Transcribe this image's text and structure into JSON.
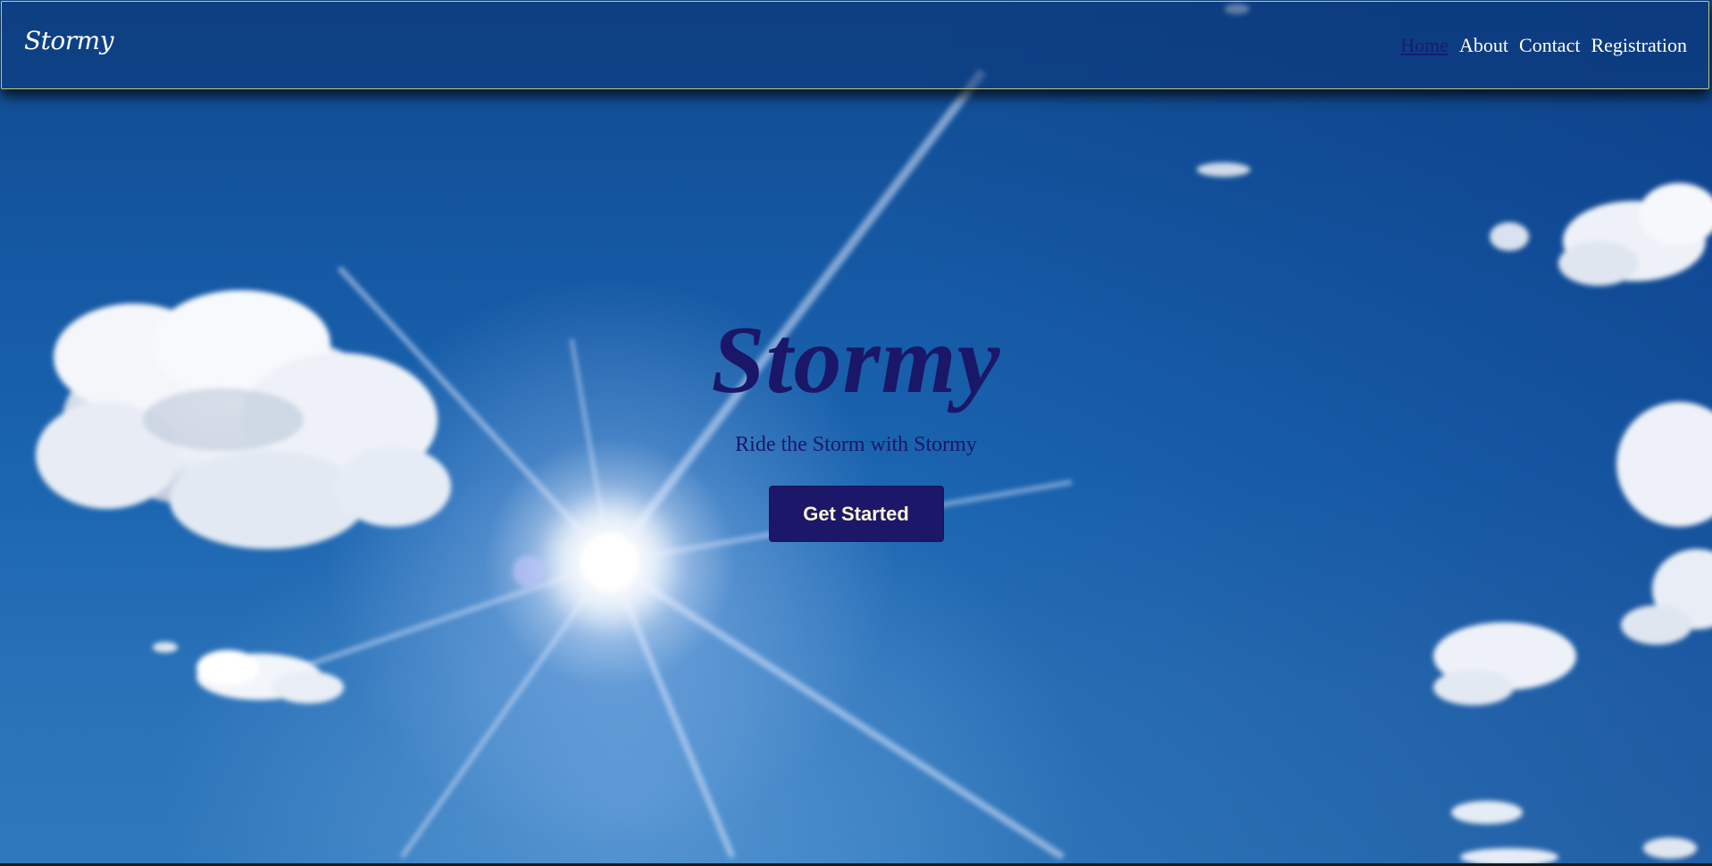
{
  "header": {
    "brand": "Stormy",
    "nav": [
      {
        "label": "Home",
        "active": true
      },
      {
        "label": "About",
        "active": false
      },
      {
        "label": "Contact",
        "active": false
      },
      {
        "label": "Registration",
        "active": false
      }
    ]
  },
  "hero": {
    "title": "Stormy",
    "subtitle": "Ride the Storm with Stormy",
    "cta_label": "Get Started"
  },
  "colors": {
    "brand_dark": "#1a1768",
    "nav_border": "#c9c96a",
    "cta_text": "#fff5d8"
  },
  "background": {
    "icon": "sunny-sky-with-clouds-image"
  }
}
